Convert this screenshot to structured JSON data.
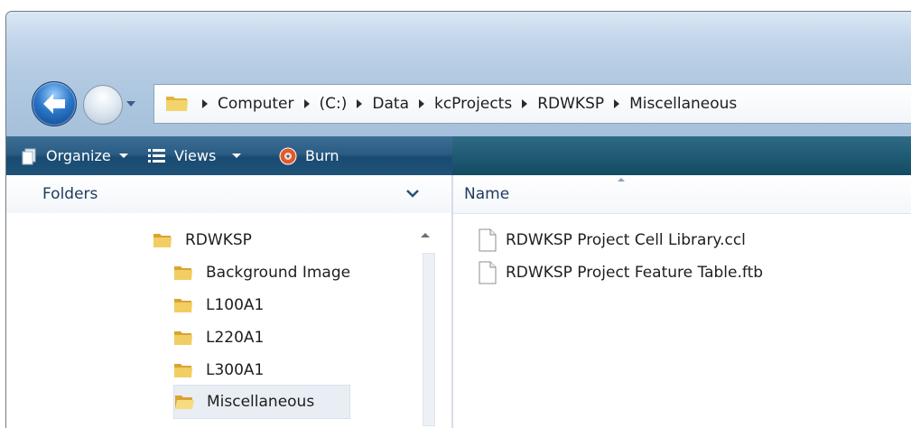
{
  "address_bar": {
    "breadcrumbs": [
      "Computer",
      "(C:)",
      "Data",
      "kcProjects",
      "RDWKSP",
      "Miscellaneous"
    ]
  },
  "toolbar": {
    "organize_label": "Organize",
    "views_label": "Views",
    "burn_label": "Burn"
  },
  "folders_pane": {
    "title": "Folders",
    "tree": [
      {
        "label": "RDWKSP",
        "level": 0
      },
      {
        "label": "Background Image",
        "level": 1
      },
      {
        "label": "L100A1",
        "level": 1
      },
      {
        "label": "L220A1",
        "level": 1
      },
      {
        "label": "L300A1",
        "level": 1
      },
      {
        "label": "Miscellaneous",
        "level": 1,
        "selected": true
      }
    ]
  },
  "file_list": {
    "column_name": "Name",
    "files": [
      {
        "name": "RDWKSP Project Cell Library.ccl"
      },
      {
        "name": "RDWKSP Project Feature Table.ftb"
      }
    ]
  },
  "colors": {
    "toolbar": "#2b5d84",
    "window_frame": "#c3d6ea",
    "folder": "#e8b93b"
  }
}
